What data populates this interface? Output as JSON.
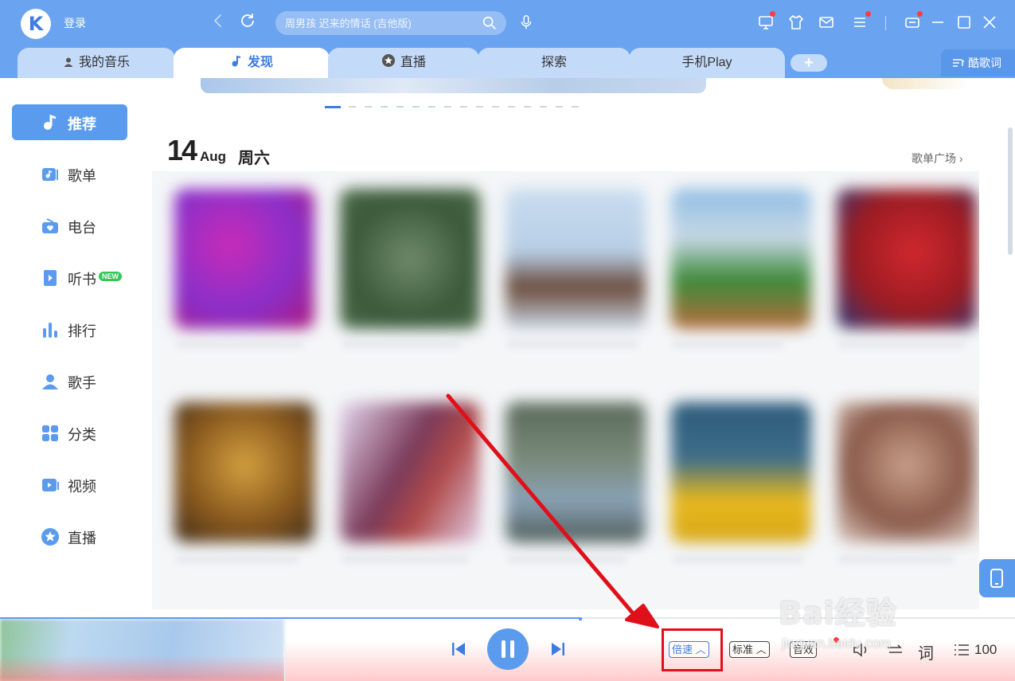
{
  "header": {
    "logo_letter": "K",
    "login_label": "登录",
    "search_placeholder": "周男孩 迟来的情话 (吉他版)"
  },
  "tabs": [
    {
      "label": "我的音乐",
      "icon": "user-icon"
    },
    {
      "label": "发现",
      "icon": "music-note-icon",
      "active": true
    },
    {
      "label": "直播",
      "icon": "star-icon"
    },
    {
      "label": "探索"
    },
    {
      "label": "手机Play"
    }
  ],
  "plus_tab": "+",
  "lyric_button": "酷歌词",
  "sidebar": {
    "items": [
      {
        "label": "推荐",
        "icon": "music-note-icon",
        "active": true
      },
      {
        "label": "歌单",
        "icon": "playlist-icon"
      },
      {
        "label": "电台",
        "icon": "radio-icon"
      },
      {
        "label": "听书",
        "icon": "book-icon",
        "badge": "NEW"
      },
      {
        "label": "排行",
        "icon": "chart-icon"
      },
      {
        "label": "歌手",
        "icon": "singer-icon"
      },
      {
        "label": "分类",
        "icon": "category-icon"
      },
      {
        "label": "视频",
        "icon": "video-icon"
      },
      {
        "label": "直播",
        "icon": "live-icon"
      }
    ]
  },
  "main": {
    "date_day": "14",
    "date_month": "Aug",
    "date_weekday": "周六",
    "more_link": "歌单广场 ›"
  },
  "player": {
    "speed_label": "倍速",
    "quality_label": "标准",
    "effect_label": "音效",
    "lyric_label": "词",
    "volume": "100",
    "progress": 0.57
  },
  "watermark": {
    "title": "Bai经验",
    "subtitle": "jingyan.baidu.com"
  },
  "colors": {
    "accent": "#3d7ce0",
    "topbar": "#6aa3f0",
    "highlight": "#e0101a"
  }
}
